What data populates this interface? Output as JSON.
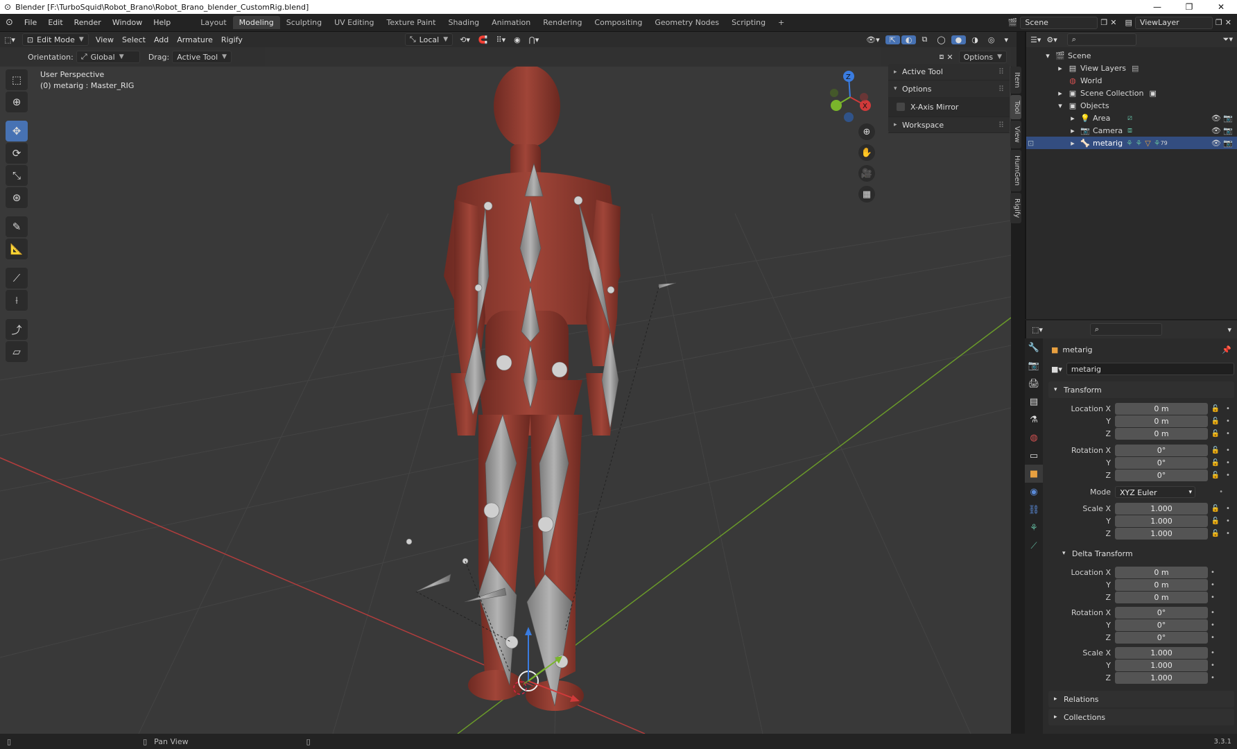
{
  "window": {
    "title": "Blender [F:\\TurboSquid\\Robot_Brano\\Robot_Brano_blender_CustomRig.blend]",
    "minimize": "—",
    "restore": "❐",
    "close": "✕"
  },
  "topbar": {
    "menus": [
      "File",
      "Edit",
      "Render",
      "Window",
      "Help"
    ],
    "tabs": [
      "Layout",
      "Modeling",
      "Sculpting",
      "UV Editing",
      "Texture Paint",
      "Shading",
      "Animation",
      "Rendering",
      "Compositing",
      "Geometry Nodes",
      "Scripting"
    ],
    "active_tab": "Modeling",
    "add_tab": "+",
    "scene": "Scene",
    "view_layer": "ViewLayer"
  },
  "viewport_header": {
    "mode": "Edit Mode",
    "menus": [
      "View",
      "Select",
      "Add",
      "Armature",
      "Rigify"
    ],
    "transform_space": "Local",
    "options_label": "Options",
    "orientation_label": "Orientation:",
    "orientation_value": "Global",
    "drag_label": "Drag:",
    "drag_value": "Active Tool"
  },
  "viewport": {
    "perspective": "User Perspective",
    "object_info": "(0) metarig : Master_RIG",
    "gizmo_z": "Z",
    "gizmo_x": "X"
  },
  "npanel": {
    "sections": [
      {
        "label": "Active Tool",
        "open": false
      },
      {
        "label": "Options",
        "open": true
      },
      {
        "label": "Workspace",
        "open": false
      }
    ],
    "x_axis_mirror": "X-Axis Mirror",
    "tabs": [
      "Item",
      "Tool",
      "View",
      "HumGen",
      "Rigify"
    ],
    "active_tab": "Tool"
  },
  "outliner": {
    "items": [
      {
        "label": "Scene",
        "indent": 0,
        "arrow": "▾",
        "icon": "🎬"
      },
      {
        "label": "View Layers",
        "indent": 1,
        "arrow": "▸",
        "icon": "▤"
      },
      {
        "label": "World",
        "indent": 1,
        "arrow": "",
        "icon": "◍"
      },
      {
        "label": "Scene Collection",
        "indent": 1,
        "arrow": "▸",
        "icon": "▣"
      },
      {
        "label": "Objects",
        "indent": 1,
        "arrow": "▾",
        "icon": "▣"
      },
      {
        "label": "Area",
        "indent": 2,
        "arrow": "▸",
        "icon": "💡"
      },
      {
        "label": "Camera",
        "indent": 2,
        "arrow": "▸",
        "icon": "📷"
      },
      {
        "label": "metarig",
        "indent": 2,
        "arrow": "▸",
        "icon": "🦴",
        "selected": true
      }
    ],
    "badge_count": "79"
  },
  "properties": {
    "object_name": "metarig",
    "data_name": "metarig",
    "transform_label": "Transform",
    "location": {
      "label": "Location X",
      "x": "0 m",
      "y": "0 m",
      "z": "0 m"
    },
    "rotation": {
      "label": "Rotation X",
      "x": "0°",
      "y": "0°",
      "z": "0°"
    },
    "mode_label": "Mode",
    "mode_value": "XYZ Euler",
    "scale": {
      "label": "Scale X",
      "x": "1.000",
      "y": "1.000",
      "z": "1.000"
    },
    "delta_label": "Delta Transform",
    "delta_location": {
      "label": "Location X",
      "x": "0 m",
      "y": "0 m",
      "z": "0 m"
    },
    "delta_rotation": {
      "label": "Rotation X",
      "x": "0°",
      "y": "0°",
      "z": "0°"
    },
    "delta_scale": {
      "label": "Scale X",
      "x": "1.000",
      "y": "1.000",
      "z": "1.000"
    },
    "y_label": "Y",
    "z_label": "Z",
    "relations": "Relations",
    "collections": "Collections"
  },
  "status": {
    "hint": "Pan View",
    "version": "3.3.1"
  },
  "colors": {
    "accent": "#4772b3",
    "robot": "#8e3a30",
    "bone": "#9a9a9a",
    "x_axis": "#c84a4a",
    "y_axis": "#7aa52b"
  }
}
